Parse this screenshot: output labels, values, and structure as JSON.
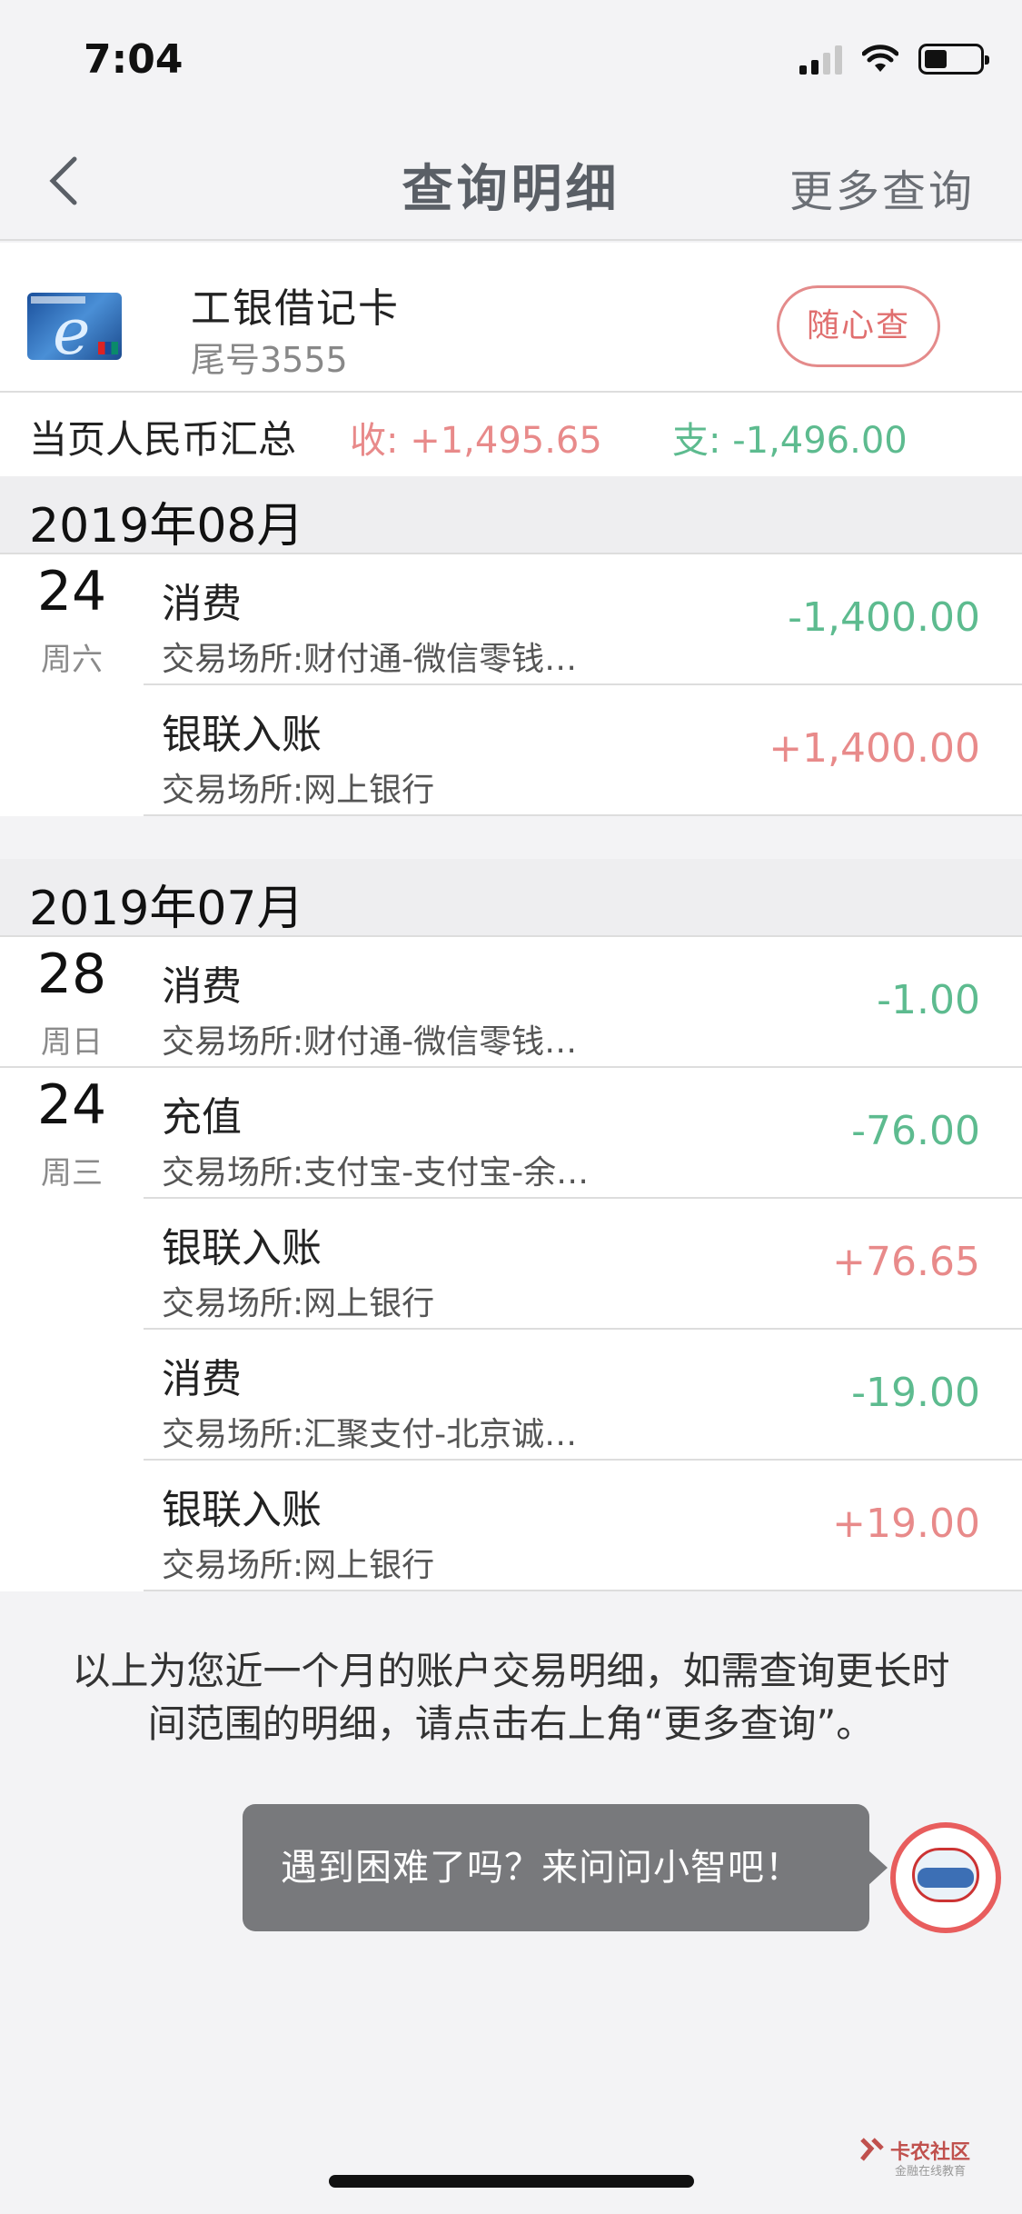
{
  "status_bar": {
    "time": "7:04"
  },
  "nav": {
    "title": "查询明细",
    "more": "更多查询"
  },
  "card": {
    "name": "工银借记卡",
    "tail": "尾号3555",
    "button": "随心查"
  },
  "summary": {
    "label": "当页人民币汇总",
    "income": "收: +1,495.65",
    "expense": "支: -1,496.00"
  },
  "months": [
    {
      "label": "2019年08月",
      "rows": [
        {
          "day": "24",
          "weekday": "周六",
          "type": "消费",
          "place": "交易场所:财付通-微信零钱…",
          "amount": "-1,400.00",
          "sign": "neg"
        },
        {
          "day": "",
          "weekday": "",
          "type": "银联入账",
          "place": "交易场所:网上银行",
          "amount": "+1,400.00",
          "sign": "pos"
        }
      ]
    },
    {
      "label": "2019年07月",
      "rows": [
        {
          "day": "28",
          "weekday": "周日",
          "type": "消费",
          "place": "交易场所:财付通-微信零钱…",
          "amount": "-1.00",
          "sign": "neg"
        },
        {
          "day": "24",
          "weekday": "周三",
          "type": "充值",
          "place": "交易场所:支付宝-支付宝-余…",
          "amount": "-76.00",
          "sign": "neg"
        },
        {
          "day": "",
          "weekday": "",
          "type": "银联入账",
          "place": "交易场所:网上银行",
          "amount": "+76.65",
          "sign": "pos"
        },
        {
          "day": "",
          "weekday": "",
          "type": "消费",
          "place": "交易场所:汇聚支付-北京诚…",
          "amount": "-19.00",
          "sign": "neg"
        },
        {
          "day": "",
          "weekday": "",
          "type": "银联入账",
          "place": "交易场所:网上银行",
          "amount": "+19.00",
          "sign": "pos"
        }
      ]
    }
  ],
  "note": {
    "line1": "以上为您近一个月的账户交易明细，如需查询更长时",
    "line2": "间范围的明细，请点击右上角“更多查询”。"
  },
  "help": {
    "text": "遇到困难了吗？来问问小智吧！"
  },
  "watermark": {
    "title": "卡农社区",
    "subtitle": "金融在线教育"
  },
  "colors": {
    "income": "#e88a8a",
    "expense": "#5dbb8f",
    "button_border": "#e48b8b"
  },
  "icons": [
    "back-chevron-icon",
    "signal-icon",
    "wifi-icon",
    "battery-icon",
    "card-logo-icon",
    "assistant-avatar-icon"
  ]
}
